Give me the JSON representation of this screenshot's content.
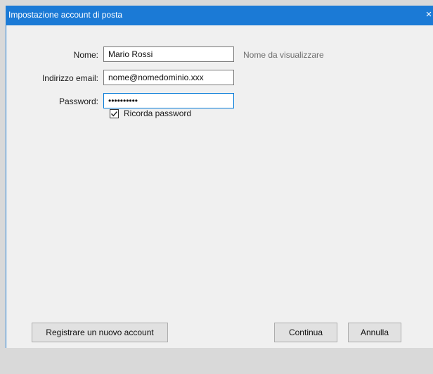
{
  "window": {
    "title": "Impostazione account di posta",
    "close_glyph": "×"
  },
  "form": {
    "name_label": "Nome:",
    "name_value": "Mario Rossi",
    "name_hint": "Nome da visualizzare",
    "email_label": "Indirizzo email:",
    "email_value": "nome@nomedominio.xxx",
    "password_label": "Password:",
    "password_value": "••••••••••",
    "remember_label": "Ricorda password",
    "remember_checked": true
  },
  "buttons": {
    "register": "Registrare un nuovo account",
    "continue": "Continua",
    "cancel": "Annulla"
  },
  "colors": {
    "accent": "#1b7ad6",
    "focus": "#0078d7"
  }
}
